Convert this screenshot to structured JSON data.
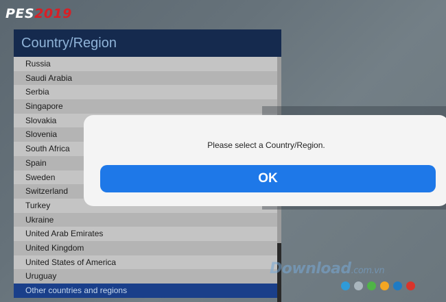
{
  "logo": {
    "pes": "PES",
    "year": "2019"
  },
  "panel": {
    "title": "Country/Region",
    "items": [
      "Russia",
      "Saudi Arabia",
      "Serbia",
      "Singapore",
      "Slovakia",
      "Slovenia",
      "South Africa",
      "Spain",
      "Sweden",
      "Switzerland",
      "Turkey",
      "Ukraine",
      "United Arab Emirates",
      "United Kingdom",
      "United States of America",
      "Uruguay",
      "Other countries and regions"
    ],
    "selected_index": 16
  },
  "dialog": {
    "message": "Please select a Country/Region.",
    "ok_label": "OK"
  },
  "watermark": {
    "main": "Download",
    "suffix": ".com.vn",
    "dot_colors": [
      "#2f9bd8",
      "#a9b6bd",
      "#4fb447",
      "#f4a623",
      "#1f7bc4",
      "#d9342b"
    ]
  },
  "colors": {
    "header_bg": "#152a4e",
    "selected_row": "#1a3f8a",
    "ok_button": "#1e78e8",
    "logo_year": "#d81f26"
  }
}
